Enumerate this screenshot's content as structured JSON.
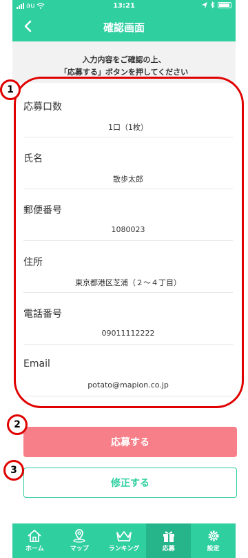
{
  "status_bar": {
    "carrier": "au",
    "time": "13:21"
  },
  "navbar": {
    "title": "確認画面",
    "back_icon": "chevron-left-icon"
  },
  "notice": {
    "line1": "入力内容をご確認の上、",
    "line2": "「応募する」ボタンを押してください"
  },
  "form": {
    "rows": [
      {
        "label": "応募口数",
        "value": "1口（1枚）"
      },
      {
        "label": "氏名",
        "value": "散歩太郎"
      },
      {
        "label": "郵便番号",
        "value": "1080023"
      },
      {
        "label": "住所",
        "value": "東京都港区芝浦（２～４丁目）"
      },
      {
        "label": "電話番号",
        "value": "09011112222"
      },
      {
        "label": "Email",
        "value": "potato@mapion.co.jp"
      }
    ]
  },
  "buttons": {
    "apply": "応募する",
    "edit": "修正する"
  },
  "tabs": [
    {
      "label": "ホーム",
      "icon": "home-icon"
    },
    {
      "label": "マップ",
      "icon": "map-pin-icon"
    },
    {
      "label": "ランキング",
      "icon": "crown-icon"
    },
    {
      "label": "応募",
      "icon": "gift-icon"
    },
    {
      "label": "設定",
      "icon": "gear-icon"
    }
  ],
  "annotations": {
    "marker1": "1",
    "marker2": "2",
    "marker3": "3"
  },
  "colors": {
    "brand": "#2fcfa0",
    "apply": "#f77f89",
    "annotation": "#e00000"
  }
}
